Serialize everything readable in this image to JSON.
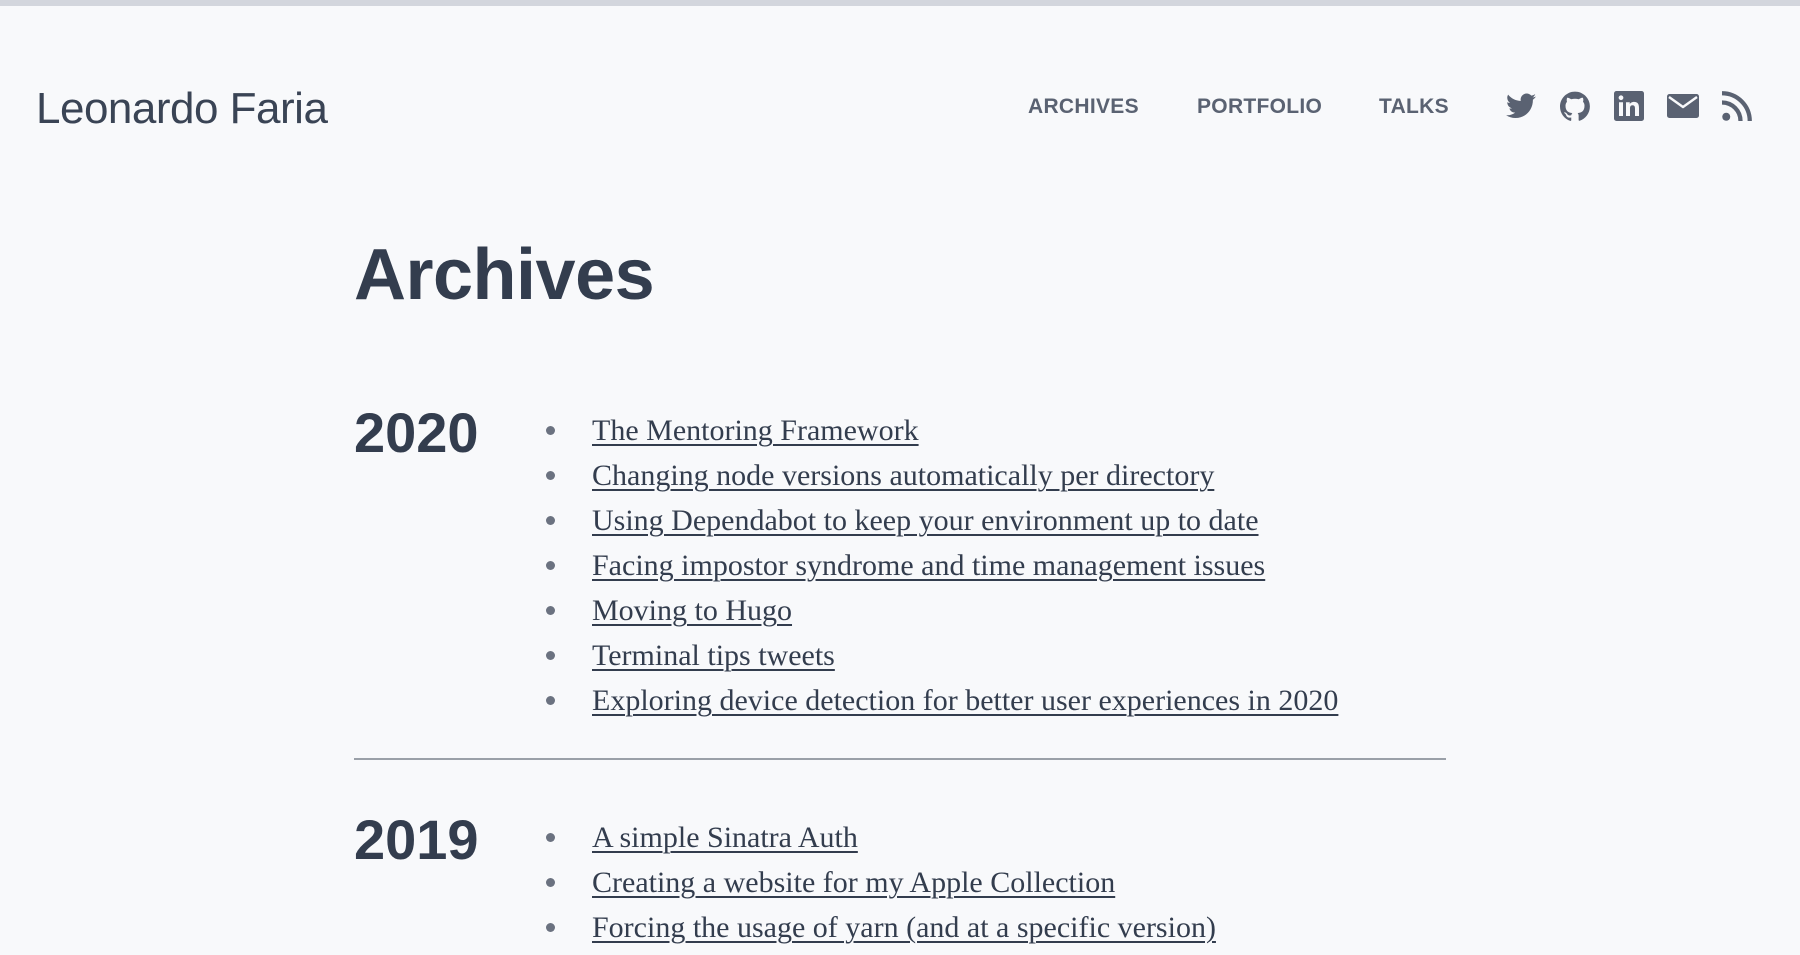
{
  "header": {
    "site_title": "Leonardo Faria",
    "nav": [
      {
        "label": "ARCHIVES"
      },
      {
        "label": "PORTFOLIO"
      },
      {
        "label": "TALKS"
      }
    ],
    "social_icons": [
      "twitter-icon",
      "github-icon",
      "linkedin-icon",
      "email-icon",
      "rss-icon"
    ]
  },
  "main": {
    "title": "Archives",
    "years": [
      {
        "year": "2020",
        "posts": [
          "The Mentoring Framework",
          "Changing node versions automatically per directory",
          "Using Dependabot to keep your environment up to date",
          "Facing impostor syndrome and time management issues",
          "Moving to Hugo",
          "Terminal tips tweets",
          "Exploring device detection for better user experiences in 2020"
        ]
      },
      {
        "year": "2019",
        "posts": [
          "A simple Sinatra Auth",
          "Creating a website for my Apple Collection",
          "Forcing the usage of yarn (and at a specific version)"
        ]
      }
    ]
  },
  "colors": {
    "background": "#f8f9fb",
    "text": "#333d4e",
    "nav": "#5a6272",
    "top_bar": "#d3d6dd",
    "divider": "#9aa0a8"
  }
}
